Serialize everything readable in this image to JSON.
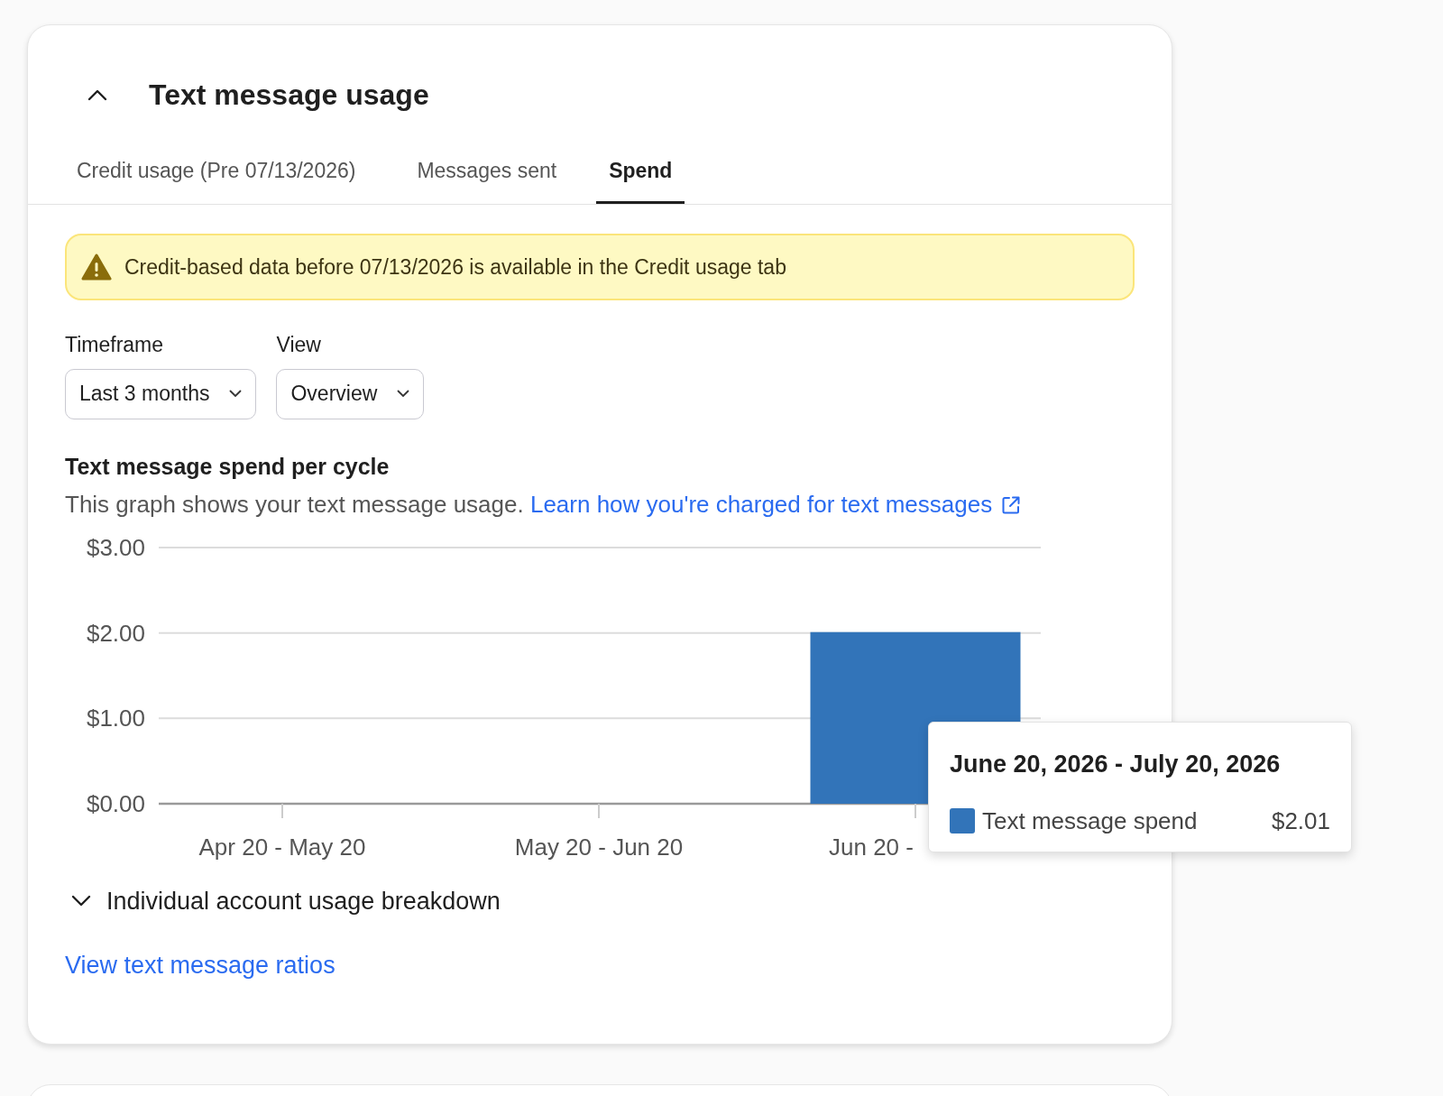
{
  "panel": {
    "title": "Text message usage",
    "expanded": true
  },
  "tabs": [
    {
      "label": "Credit usage (Pre 07/13/2026)",
      "selected": false
    },
    {
      "label": "Messages sent",
      "selected": false
    },
    {
      "label": "Spend",
      "selected": true
    }
  ],
  "notice": {
    "kind": "warning",
    "text": "Credit-based data before 07/13/2026 is available in the Credit usage tab"
  },
  "filters": [
    {
      "label": "Timeframe",
      "value": "Last 3 months"
    },
    {
      "label": "View",
      "value": "Overview"
    }
  ],
  "chart_section": {
    "title": "Text message spend per cycle",
    "description": "This graph shows your text message usage.",
    "link": "Learn how you're charged for text messages",
    "chart_data": {
      "type": "bar",
      "categories": [
        "Apr 20 - May 20",
        "May 20 - Jun 20",
        "Jun 20 -"
      ],
      "series": [
        {
          "name": "Text message spend",
          "color": "#3274b9",
          "values": [
            0,
            0,
            2.01
          ]
        }
      ],
      "ylim": [
        0,
        3
      ],
      "yticks": [
        {
          "value": 0,
          "label": "$0.00"
        },
        {
          "value": 1,
          "label": "$1.00"
        },
        {
          "value": 2,
          "label": "$2.00"
        },
        {
          "value": 3,
          "label": "$3.00"
        }
      ]
    },
    "tooltip": {
      "title": "June 20, 2026 - July 20, 2026",
      "value": "$2.01"
    }
  },
  "breakdown": {
    "label": "Individual account usage breakdown",
    "expanded": false
  },
  "footer_link": "View text message ratios"
}
